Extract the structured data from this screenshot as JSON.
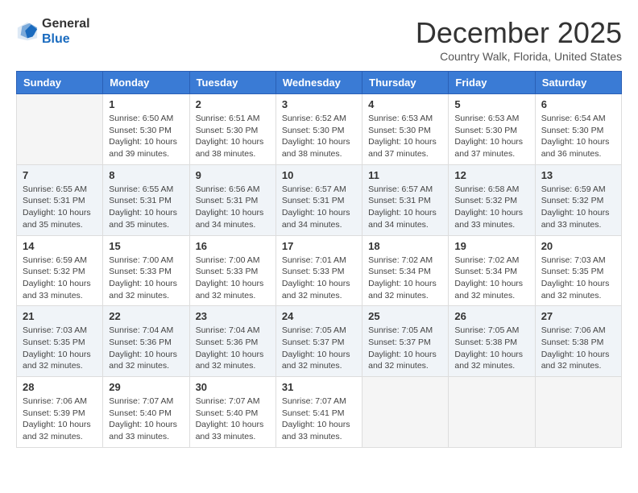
{
  "header": {
    "logo_line1": "General",
    "logo_line2": "Blue",
    "month_title": "December 2025",
    "location": "Country Walk, Florida, United States"
  },
  "days_of_week": [
    "Sunday",
    "Monday",
    "Tuesday",
    "Wednesday",
    "Thursday",
    "Friday",
    "Saturday"
  ],
  "weeks": [
    [
      {
        "day": "",
        "info": ""
      },
      {
        "day": "1",
        "info": "Sunrise: 6:50 AM\nSunset: 5:30 PM\nDaylight: 10 hours\nand 39 minutes."
      },
      {
        "day": "2",
        "info": "Sunrise: 6:51 AM\nSunset: 5:30 PM\nDaylight: 10 hours\nand 38 minutes."
      },
      {
        "day": "3",
        "info": "Sunrise: 6:52 AM\nSunset: 5:30 PM\nDaylight: 10 hours\nand 38 minutes."
      },
      {
        "day": "4",
        "info": "Sunrise: 6:53 AM\nSunset: 5:30 PM\nDaylight: 10 hours\nand 37 minutes."
      },
      {
        "day": "5",
        "info": "Sunrise: 6:53 AM\nSunset: 5:30 PM\nDaylight: 10 hours\nand 37 minutes."
      },
      {
        "day": "6",
        "info": "Sunrise: 6:54 AM\nSunset: 5:30 PM\nDaylight: 10 hours\nand 36 minutes."
      }
    ],
    [
      {
        "day": "7",
        "info": "Sunrise: 6:55 AM\nSunset: 5:31 PM\nDaylight: 10 hours\nand 35 minutes."
      },
      {
        "day": "8",
        "info": "Sunrise: 6:55 AM\nSunset: 5:31 PM\nDaylight: 10 hours\nand 35 minutes."
      },
      {
        "day": "9",
        "info": "Sunrise: 6:56 AM\nSunset: 5:31 PM\nDaylight: 10 hours\nand 34 minutes."
      },
      {
        "day": "10",
        "info": "Sunrise: 6:57 AM\nSunset: 5:31 PM\nDaylight: 10 hours\nand 34 minutes."
      },
      {
        "day": "11",
        "info": "Sunrise: 6:57 AM\nSunset: 5:31 PM\nDaylight: 10 hours\nand 34 minutes."
      },
      {
        "day": "12",
        "info": "Sunrise: 6:58 AM\nSunset: 5:32 PM\nDaylight: 10 hours\nand 33 minutes."
      },
      {
        "day": "13",
        "info": "Sunrise: 6:59 AM\nSunset: 5:32 PM\nDaylight: 10 hours\nand 33 minutes."
      }
    ],
    [
      {
        "day": "14",
        "info": "Sunrise: 6:59 AM\nSunset: 5:32 PM\nDaylight: 10 hours\nand 33 minutes."
      },
      {
        "day": "15",
        "info": "Sunrise: 7:00 AM\nSunset: 5:33 PM\nDaylight: 10 hours\nand 32 minutes."
      },
      {
        "day": "16",
        "info": "Sunrise: 7:00 AM\nSunset: 5:33 PM\nDaylight: 10 hours\nand 32 minutes."
      },
      {
        "day": "17",
        "info": "Sunrise: 7:01 AM\nSunset: 5:33 PM\nDaylight: 10 hours\nand 32 minutes."
      },
      {
        "day": "18",
        "info": "Sunrise: 7:02 AM\nSunset: 5:34 PM\nDaylight: 10 hours\nand 32 minutes."
      },
      {
        "day": "19",
        "info": "Sunrise: 7:02 AM\nSunset: 5:34 PM\nDaylight: 10 hours\nand 32 minutes."
      },
      {
        "day": "20",
        "info": "Sunrise: 7:03 AM\nSunset: 5:35 PM\nDaylight: 10 hours\nand 32 minutes."
      }
    ],
    [
      {
        "day": "21",
        "info": "Sunrise: 7:03 AM\nSunset: 5:35 PM\nDaylight: 10 hours\nand 32 minutes."
      },
      {
        "day": "22",
        "info": "Sunrise: 7:04 AM\nSunset: 5:36 PM\nDaylight: 10 hours\nand 32 minutes."
      },
      {
        "day": "23",
        "info": "Sunrise: 7:04 AM\nSunset: 5:36 PM\nDaylight: 10 hours\nand 32 minutes."
      },
      {
        "day": "24",
        "info": "Sunrise: 7:05 AM\nSunset: 5:37 PM\nDaylight: 10 hours\nand 32 minutes."
      },
      {
        "day": "25",
        "info": "Sunrise: 7:05 AM\nSunset: 5:37 PM\nDaylight: 10 hours\nand 32 minutes."
      },
      {
        "day": "26",
        "info": "Sunrise: 7:05 AM\nSunset: 5:38 PM\nDaylight: 10 hours\nand 32 minutes."
      },
      {
        "day": "27",
        "info": "Sunrise: 7:06 AM\nSunset: 5:38 PM\nDaylight: 10 hours\nand 32 minutes."
      }
    ],
    [
      {
        "day": "28",
        "info": "Sunrise: 7:06 AM\nSunset: 5:39 PM\nDaylight: 10 hours\nand 32 minutes."
      },
      {
        "day": "29",
        "info": "Sunrise: 7:07 AM\nSunset: 5:40 PM\nDaylight: 10 hours\nand 33 minutes."
      },
      {
        "day": "30",
        "info": "Sunrise: 7:07 AM\nSunset: 5:40 PM\nDaylight: 10 hours\nand 33 minutes."
      },
      {
        "day": "31",
        "info": "Sunrise: 7:07 AM\nSunset: 5:41 PM\nDaylight: 10 hours\nand 33 minutes."
      },
      {
        "day": "",
        "info": ""
      },
      {
        "day": "",
        "info": ""
      },
      {
        "day": "",
        "info": ""
      }
    ]
  ]
}
